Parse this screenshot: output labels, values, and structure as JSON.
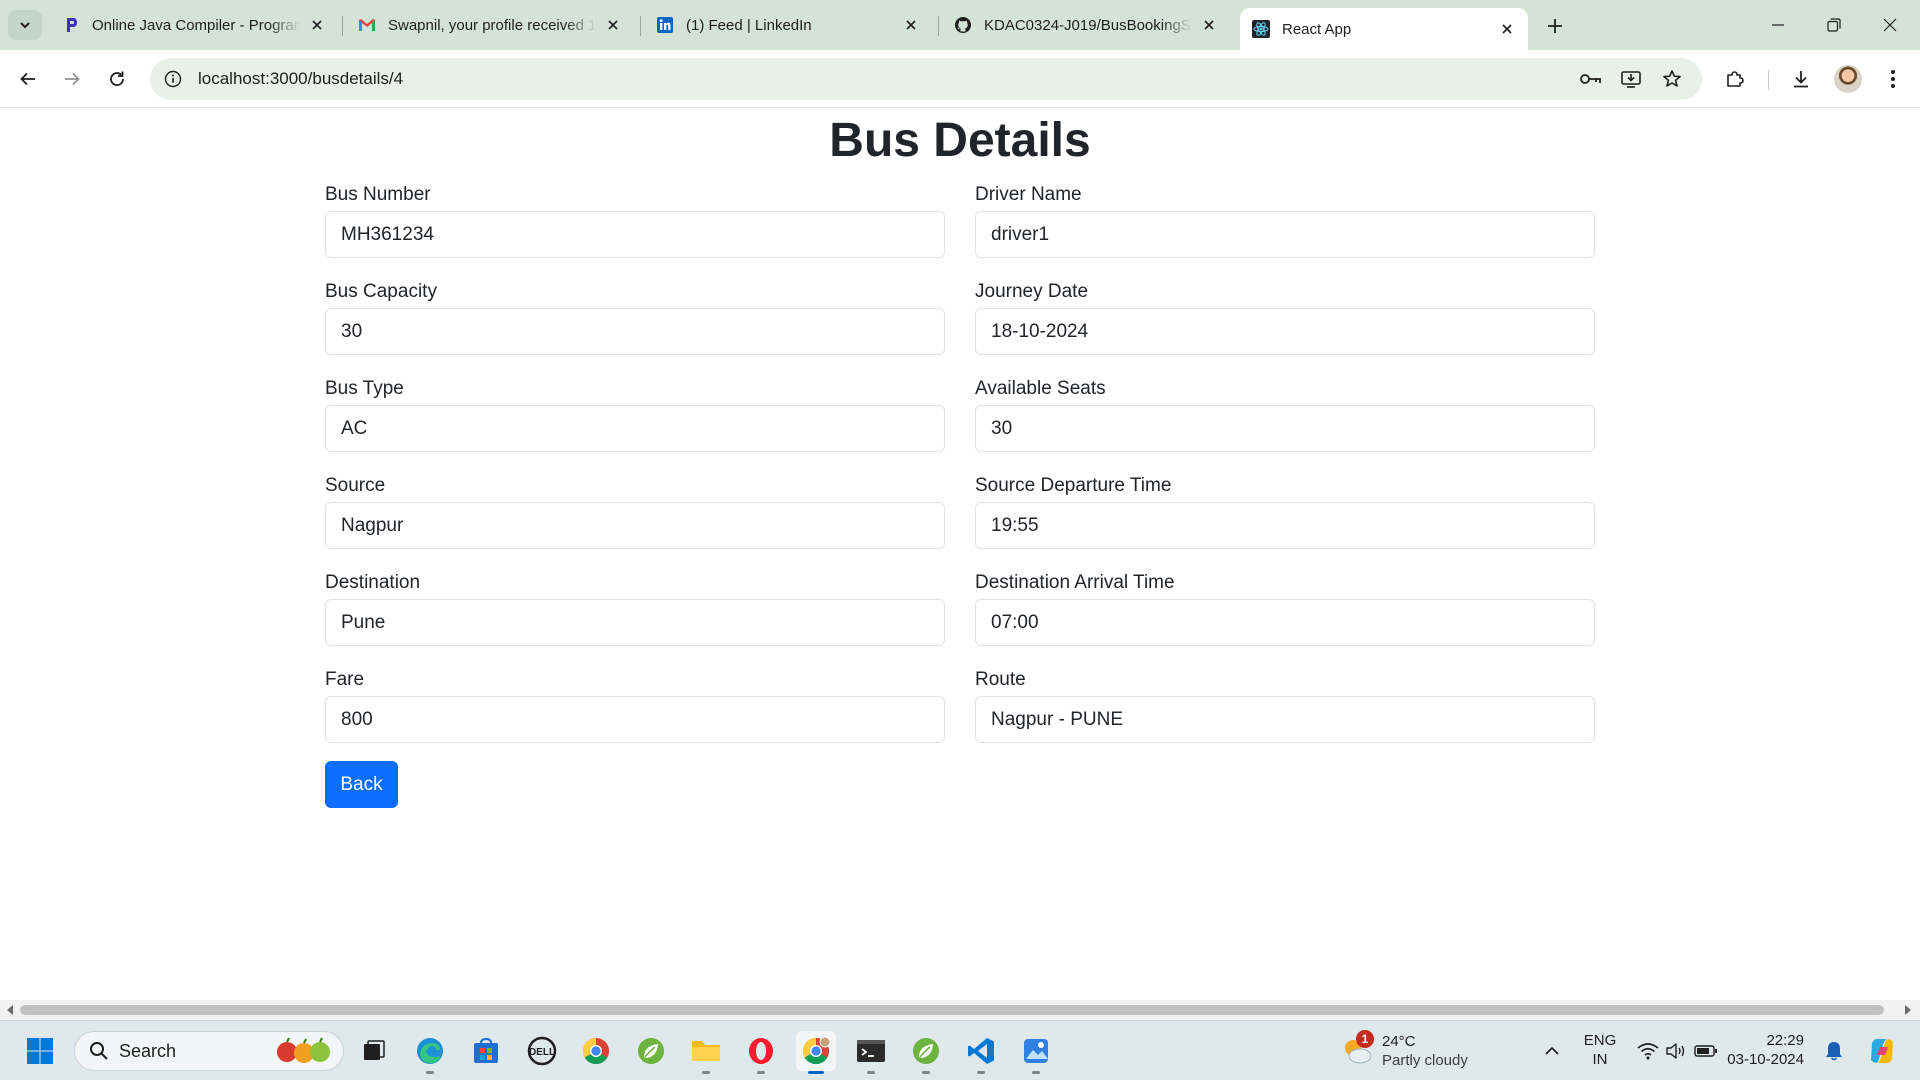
{
  "browser": {
    "tabs": [
      {
        "title": "Online Java Compiler - Programiz",
        "icon": "programiz-icon"
      },
      {
        "title": "Swapnil, your profile received 1",
        "icon": "gmail-icon"
      },
      {
        "title": "(1) Feed | LinkedIn",
        "icon": "linkedin-icon"
      },
      {
        "title": "KDAC0324-J019/BusBookingSystem",
        "icon": "github-icon"
      },
      {
        "title": "React App",
        "icon": "react-icon",
        "active": true
      }
    ],
    "url": "localhost:3000/busdetails/4"
  },
  "page": {
    "title": "Bus Details",
    "fields": {
      "bus_number": {
        "label": "Bus Number",
        "value": "MH361234"
      },
      "driver_name": {
        "label": "Driver Name",
        "value": "driver1"
      },
      "bus_capacity": {
        "label": "Bus Capacity",
        "value": "30"
      },
      "journey_date": {
        "label": "Journey Date",
        "value": "18-10-2024"
      },
      "bus_type": {
        "label": "Bus Type",
        "value": "AC"
      },
      "available_seats": {
        "label": "Available Seats",
        "value": "30"
      },
      "source": {
        "label": "Source",
        "value": "Nagpur"
      },
      "source_departure_time": {
        "label": "Source Departure Time",
        "value": "19:55"
      },
      "destination": {
        "label": "Destination",
        "value": "Pune"
      },
      "destination_arrival_time": {
        "label": "Destination Arrival Time",
        "value": "07:00"
      },
      "fare": {
        "label": "Fare",
        "value": "800"
      },
      "route": {
        "label": "Route",
        "value": "Nagpur - PUNE"
      }
    },
    "back_label": "Back"
  },
  "taskbar": {
    "search_label": "Search",
    "weather_badge": "1",
    "temperature": "24°C",
    "condition": "Partly cloudy",
    "lang_top": "ENG",
    "lang_bottom": "IN",
    "time": "22:29",
    "date": "03-10-2024"
  },
  "colors": {
    "primary_button": "#0d6efd",
    "tabstrip": "#d3e3d6",
    "omnibox": "#e9efe9"
  }
}
